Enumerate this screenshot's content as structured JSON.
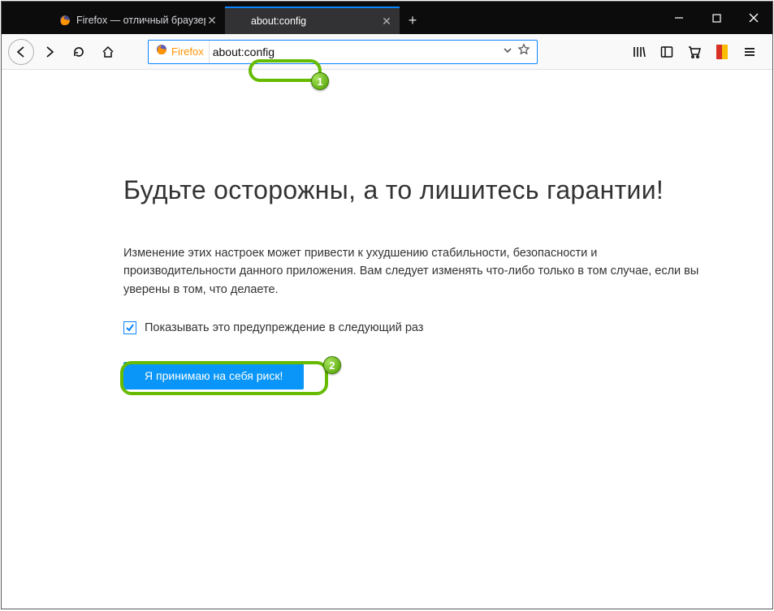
{
  "tabs": [
    {
      "label": "Firefox — отличный браузер д",
      "active": false
    },
    {
      "label": "about:config",
      "active": true
    }
  ],
  "addressbar": {
    "identity_label": "Firefox",
    "url": "about:config"
  },
  "callouts": {
    "one": "1",
    "two": "2"
  },
  "warning": {
    "title": "Будьте осторожны, а то лишитесь гарантии!",
    "description": "Изменение этих настроек может привести к ухудшению стабильности, безопасности и производительности данного приложения. Вам следует изменять что-либо только в том случае, если вы уверены в том, что делаете.",
    "checkbox_label": "Показывать это предупреждение в следующий раз",
    "accept_label": "Я принимаю на себя риск!"
  }
}
